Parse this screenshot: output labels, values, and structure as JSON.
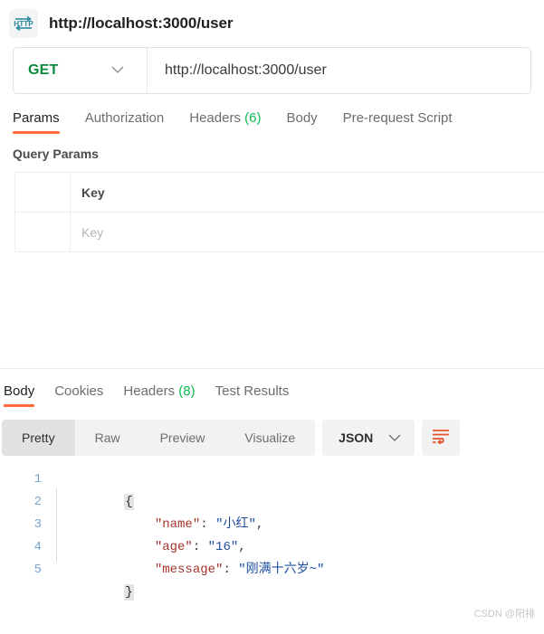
{
  "header": {
    "icon": "http-protocol-icon",
    "title": "http://localhost:3000/user"
  },
  "request": {
    "method": "GET",
    "method_color": "#0a8b3c",
    "url": "http://localhost:3000/user",
    "tabs": [
      {
        "label": "Params",
        "count": "",
        "active": true
      },
      {
        "label": "Authorization",
        "count": "",
        "active": false
      },
      {
        "label": "Headers",
        "count": "(6)",
        "active": false
      },
      {
        "label": "Body",
        "count": "",
        "active": false
      },
      {
        "label": "Pre-request Script",
        "count": "",
        "active": false
      }
    ],
    "query_params": {
      "section_title": "Query Params",
      "columns": [
        "Key"
      ],
      "rows": [
        {
          "key_placeholder": "Key"
        }
      ]
    }
  },
  "response": {
    "tabs": [
      {
        "label": "Body",
        "count": "",
        "active": true
      },
      {
        "label": "Cookies",
        "count": "",
        "active": false
      },
      {
        "label": "Headers",
        "count": "(8)",
        "active": false
      },
      {
        "label": "Test Results",
        "count": "",
        "active": false
      }
    ],
    "view_modes": [
      {
        "label": "Pretty",
        "active": true
      },
      {
        "label": "Raw",
        "active": false
      },
      {
        "label": "Preview",
        "active": false
      },
      {
        "label": "Visualize",
        "active": false
      }
    ],
    "format": "JSON",
    "wrap_icon": "word-wrap-icon",
    "line_numbers": [
      "1",
      "2",
      "3",
      "4",
      "5"
    ],
    "body": {
      "open_brace": "{",
      "close_brace": "}",
      "entries": [
        {
          "key": "\"name\"",
          "sep": ": ",
          "value": "\"小红\"",
          "comma": ","
        },
        {
          "key": "\"age\"",
          "sep": ": ",
          "value": "\"16\"",
          "comma": ","
        },
        {
          "key": "\"message\"",
          "sep": ": ",
          "value": "\"刚满十六岁~\"",
          "comma": ""
        }
      ]
    }
  },
  "colors": {
    "accent": "#ff6c37",
    "count_green": "#0cbb52",
    "method_green": "#0a8b3c",
    "json_key": "#a3352c",
    "json_string": "#1f4fa3",
    "gutter": "#7ba7d1"
  },
  "watermark": "CSDN @阳排"
}
